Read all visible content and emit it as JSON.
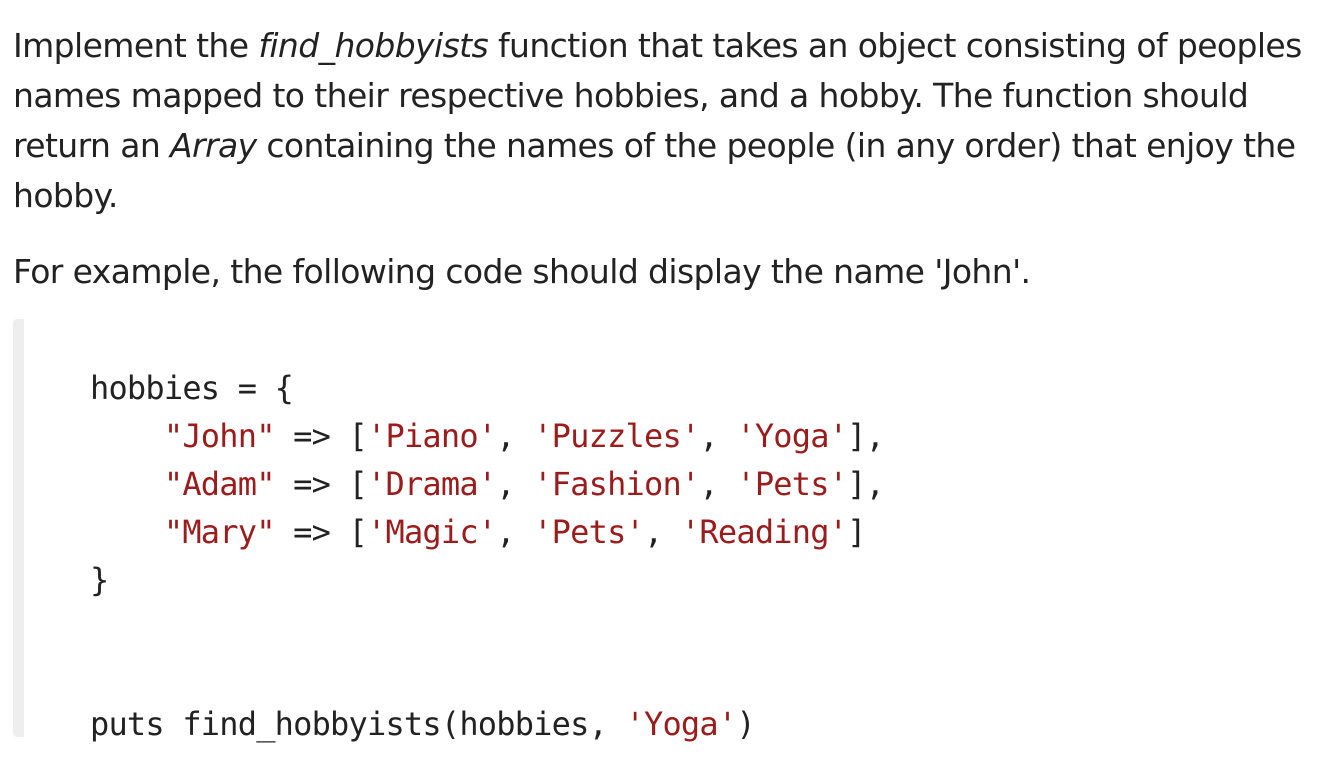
{
  "prose": {
    "p1": {
      "part1": "Implement the ",
      "fn_name": "find_hobbyists",
      "part2": " function that takes an object consisting of peoples names mapped to their respective hobbies, and a hobby. The function should return an ",
      "type_name": "Array",
      "part3": " containing the names of the people (in any order) that enjoy the hobby."
    },
    "p2": "For example, the following code should display the name 'John'."
  },
  "code": {
    "line1": "hobbies = {",
    "rows": [
      {
        "indent": "    ",
        "key": "\"John\"",
        "arrow": " => [",
        "v1": "'Piano'",
        "sep1": ", ",
        "v2": "'Puzzles'",
        "sep2": ", ",
        "v3": "'Yoga'",
        "end": "],"
      },
      {
        "indent": "    ",
        "key": "\"Adam\"",
        "arrow": " => [",
        "v1": "'Drama'",
        "sep1": ", ",
        "v2": "'Fashion'",
        "sep2": ", ",
        "v3": "'Pets'",
        "end": "],"
      },
      {
        "indent": "    ",
        "key": "\"Mary\"",
        "arrow": " => [",
        "v1": "'Magic'",
        "sep1": ", ",
        "v2": "'Pets'",
        "sep2": ", ",
        "v3": "'Reading'",
        "end": "]"
      }
    ],
    "close": "}",
    "call_prefix": "puts find_hobbyists(hobbies, ",
    "call_arg": "'Yoga'",
    "call_suffix": ")"
  },
  "colors": {
    "text": "#222222",
    "string": "#9b1c1c",
    "code_border": "#eeeeee"
  }
}
